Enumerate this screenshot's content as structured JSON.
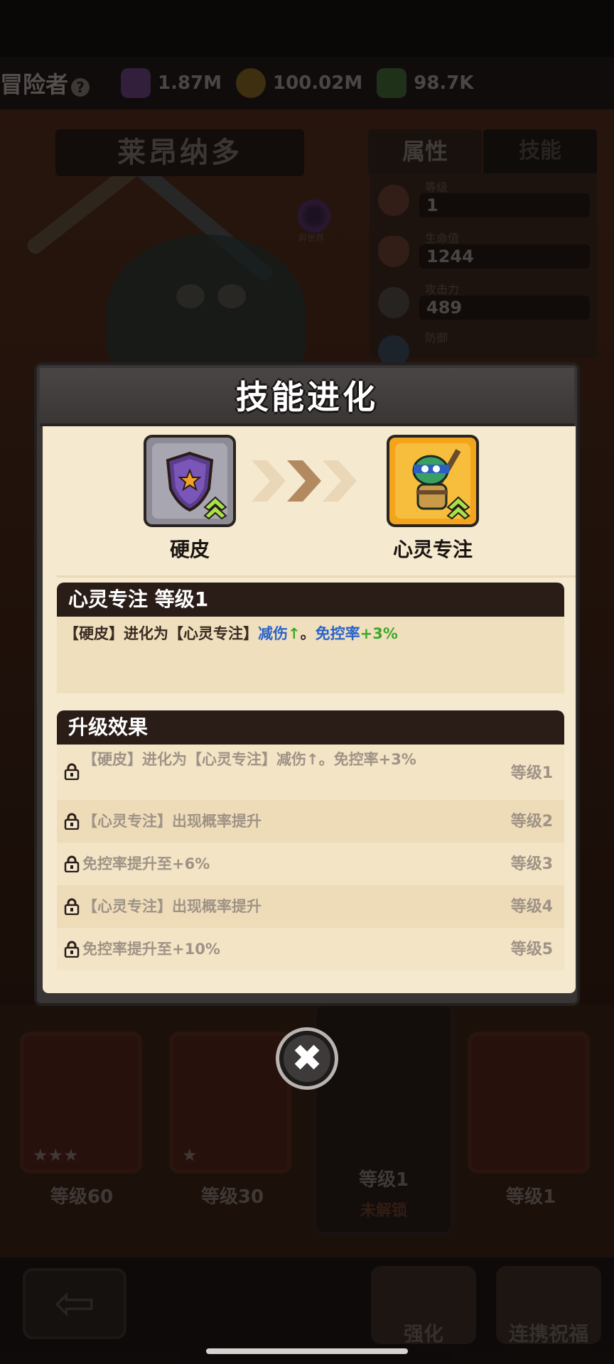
{
  "topbar": {
    "title": "冒险者",
    "resources": [
      {
        "icon": "purple-gem-icon",
        "value": "1.87M"
      },
      {
        "icon": "gold-coin-icon",
        "value": "100.02M"
      },
      {
        "icon": "green-crystal-icon",
        "value": "98.7K"
      }
    ]
  },
  "hero": {
    "name": "莱昂纳多",
    "tabs": [
      "属性",
      "技能"
    ],
    "swirl_label": "异世界",
    "stats": [
      {
        "label": "等级",
        "value": "1"
      },
      {
        "label": "生命值",
        "value": "1244"
      },
      {
        "label": "攻击力",
        "value": "489"
      },
      {
        "label": "防御",
        "value": ""
      }
    ]
  },
  "modal": {
    "title": "技能进化",
    "from_skill": "硬皮",
    "to_skill": "心灵专注",
    "current": {
      "heading": "心灵专注 等级1",
      "text_prefix": "【硬皮】进化为【心灵专注】",
      "effect1": "减伤",
      "arrow": "↑",
      "sep": "。",
      "effect2": "免控率",
      "effect2_value": "+3%"
    },
    "upgrade": {
      "heading": "升级效果",
      "rows": [
        {
          "text": "【硬皮】进化为【心灵专注】减伤↑。免控率+3%",
          "level": "等级1"
        },
        {
          "text": "【心灵专注】出现概率提升",
          "level": "等级2"
        },
        {
          "text": "免控率提升至+6%",
          "level": "等级3"
        },
        {
          "text": "【心灵专注】出现概率提升",
          "level": "等级4"
        },
        {
          "text": "免控率提升至+10%",
          "level": "等级5"
        }
      ]
    },
    "close_glyph": "✖"
  },
  "cards": [
    {
      "level": "等级60",
      "stars": "★★★"
    },
    {
      "level": "等级30",
      "stars": "★"
    },
    {
      "level": "等级1",
      "status": "未解锁"
    },
    {
      "level": "等级1",
      "stars": ""
    }
  ],
  "bottom": {
    "back_glyph": "⇦",
    "buttons": [
      "强化",
      "连携祝福"
    ]
  },
  "colors": {
    "modal_frame": "#393535",
    "modal_body": "#f5e9cf",
    "section_head": "#2a1d18",
    "effect_blue": "#2a63c9",
    "effect_green": "#3fa82a"
  }
}
